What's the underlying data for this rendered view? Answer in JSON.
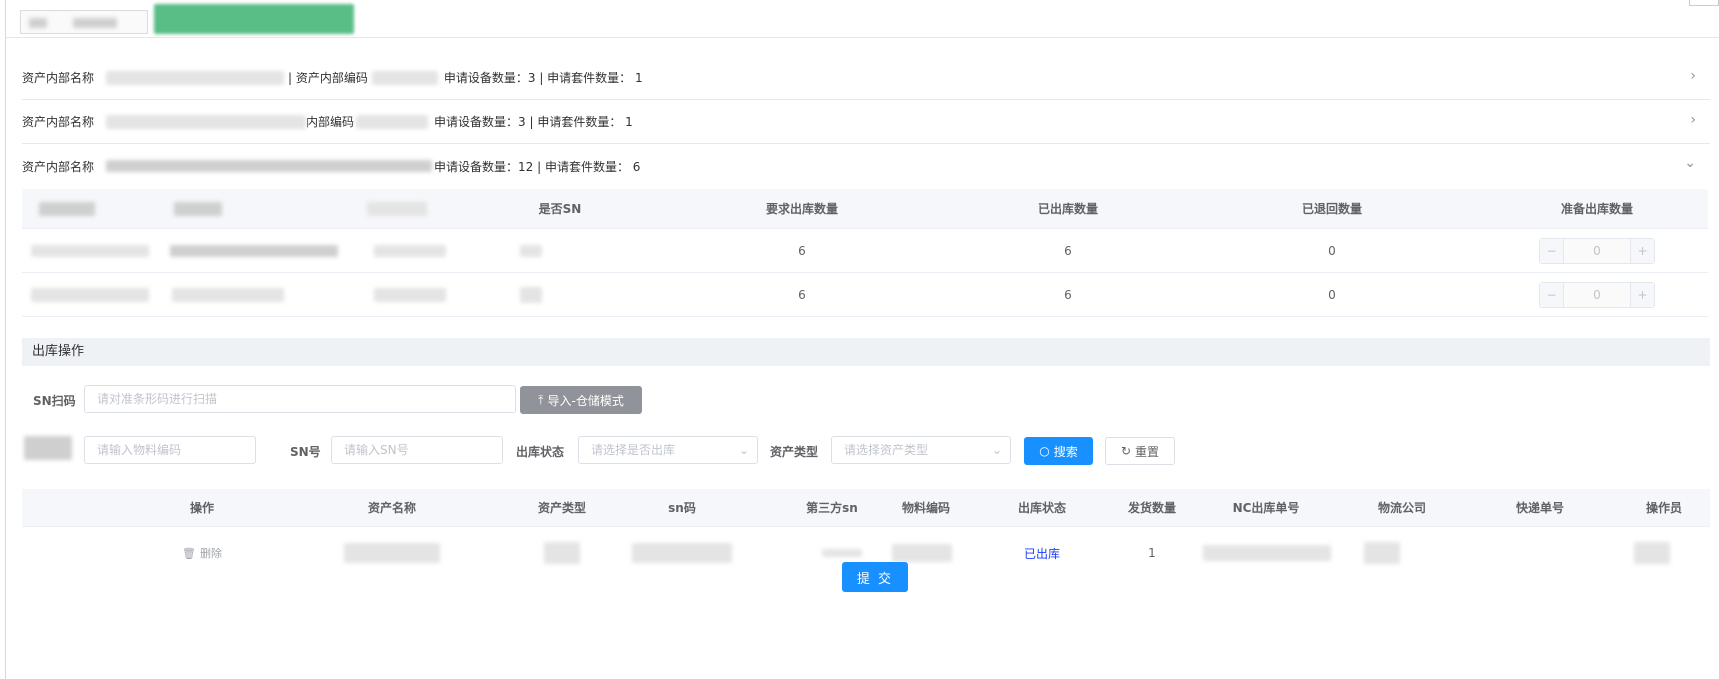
{
  "collapse": [
    {
      "name_label": "资产内部名称",
      "code_label": "| 资产内部编码",
      "summary": "申请设备数量：3 | 申请套件数量： 1",
      "expanded": false
    },
    {
      "name_label": "资产内部名称",
      "code_label": "内部编码",
      "summary": "申请设备数量：3 | 申请套件数量： 1",
      "expanded": false
    },
    {
      "name_label": "资产内部名称",
      "code_label": "",
      "summary": "申请设备数量：12 | 申请套件数量： 6",
      "expanded": true
    }
  ],
  "inner_table": {
    "headers": [
      "",
      "",
      "",
      "是否SN",
      "要求出库数量",
      "已出库数量",
      "已退回数量",
      "准备出库数量"
    ],
    "rows": [
      {
        "required": "6",
        "outbound": "6",
        "returned": "0",
        "prepare": "0"
      },
      {
        "required": "6",
        "outbound": "6",
        "returned": "0",
        "prepare": "0"
      }
    ],
    "minus": "−",
    "plus": "+"
  },
  "section_title": "出库操作",
  "form": {
    "sn_scan_label": "SN扫码",
    "sn_scan_placeholder": "请对准条形码进行扫描",
    "import_button": "导入-仓储模式",
    "material_placeholder": "请输入物料编码",
    "sn_label": "SN号",
    "sn_placeholder": "请输入SN号",
    "status_label": "出库状态",
    "status_placeholder": "请选择是否出库",
    "type_label": "资产类型",
    "type_placeholder": "请选择资产类型",
    "search_button": "搜索",
    "reset_button": "重置"
  },
  "bottom_table": {
    "headers": [
      "操作",
      "资产名称",
      "资产类型",
      "sn码",
      "第三方sn",
      "物料编码",
      "出库状态",
      "发货数量",
      "NC出库单号",
      "物流公司",
      "快递单号",
      "操作员"
    ],
    "rows": [
      {
        "action": "删除",
        "status": "已出库",
        "quantity": "1"
      }
    ]
  },
  "submit_button": "提 交",
  "icons": {
    "chevron_right": "›",
    "chevron_down": "⌄",
    "upload": "⤒",
    "search": "○",
    "refresh": "↻",
    "trash": "🗑"
  }
}
